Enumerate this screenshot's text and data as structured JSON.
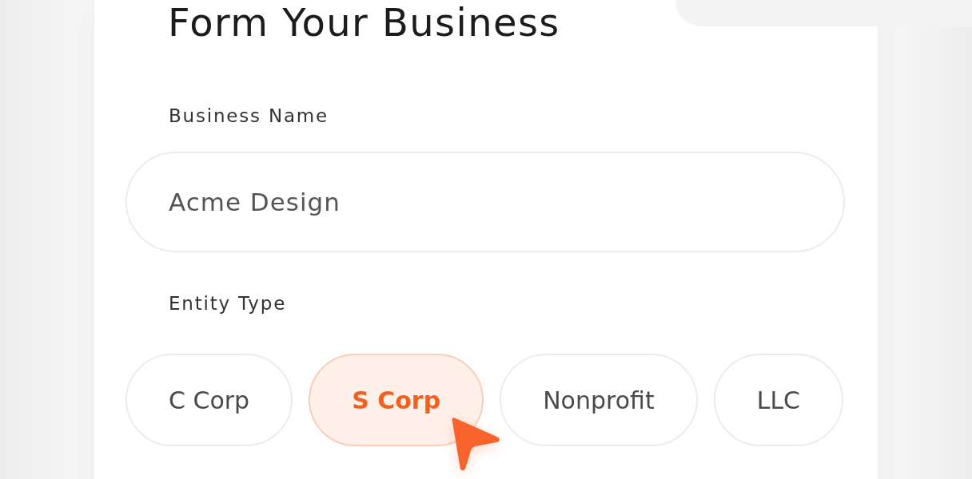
{
  "form": {
    "title": "Form Your Business",
    "business_name": {
      "label": "Business Name",
      "value": "Acme Design"
    },
    "entity_type": {
      "label": "Entity Type",
      "options": [
        {
          "label": "C Corp",
          "selected": false
        },
        {
          "label": "S Corp",
          "selected": true
        },
        {
          "label": "Nonprofit",
          "selected": false
        },
        {
          "label": "LLC",
          "selected": false
        }
      ]
    }
  }
}
